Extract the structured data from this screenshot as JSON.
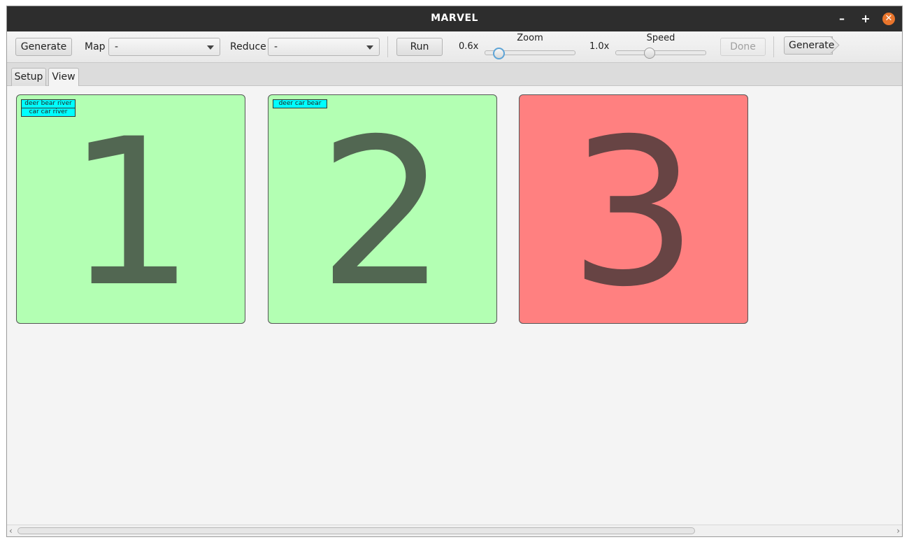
{
  "window": {
    "title": "MARVEL"
  },
  "window_controls": {
    "minimize": "–",
    "maximize": "+",
    "close": "✕"
  },
  "toolbar": {
    "generate_label": "Generate",
    "map_label": "Map",
    "map_value": "-",
    "reduce_label": "Reduce",
    "reduce_value": "-",
    "run_label": "Run",
    "zoom_value": "0.6x",
    "zoom_label": "Zoom",
    "zoom_level": 0.0,
    "speed_value": "1.0x",
    "speed_label": "Speed",
    "speed_level": 0.3,
    "done_label": "Done",
    "generate_next_label": "Generate"
  },
  "tabs": [
    {
      "label": "Setup",
      "active": false
    },
    {
      "label": "View",
      "active": true
    }
  ],
  "cards": [
    {
      "number": "1",
      "color": "#b3ffb3",
      "tags": [
        "deer bear river",
        "car car river"
      ]
    },
    {
      "number": "2",
      "color": "#b3ffb3",
      "tags": [
        "deer car bear"
      ]
    },
    {
      "number": "3",
      "color": "#ff8080",
      "tags": []
    }
  ],
  "scrollbar": {
    "left_arrow": "‹",
    "right_arrow": "›"
  }
}
